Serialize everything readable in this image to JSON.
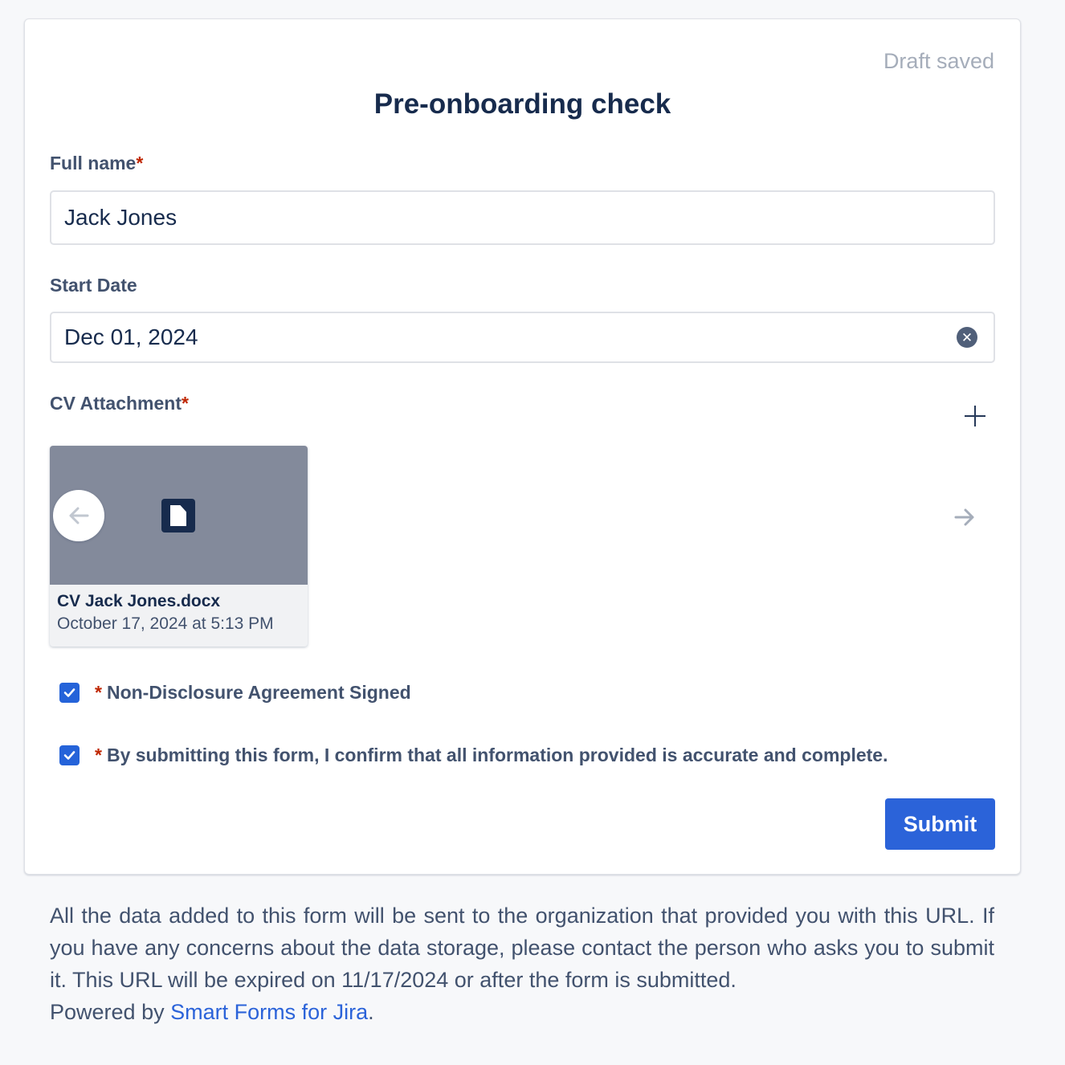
{
  "form": {
    "status": "Draft saved",
    "title": "Pre-onboarding check",
    "required_marker": "*",
    "full_name": {
      "label": "Full name",
      "value": "Jack Jones"
    },
    "start_date": {
      "label": "Start Date",
      "value": "Dec 01, 2024",
      "clear_icon": "close-circle-icon"
    },
    "cv_attachment": {
      "label": "CV Attachment",
      "add_icon": "plus-icon",
      "file_name": "CV Jack Jones.docx",
      "uploaded": "October 17, 2024 at 5:13 PM",
      "file_icon": "document-icon",
      "prev_icon": "arrow-left-icon",
      "next_icon": "arrow-right-icon"
    },
    "checkboxes": [
      {
        "label": "Non-Disclosure Agreement Signed",
        "checked": true
      },
      {
        "label": "By submitting this form, I confirm that all information provided is accurate and complete.",
        "checked": true
      }
    ],
    "submit_label": "Submit"
  },
  "footer": {
    "text": "All the data added to this form will be sent to the organization that provided you with this URL. If you have any concerns about the data storage, please contact the person who asks you to submit it. This URL will be expired on 11/17/2024 or after the form is submitted.",
    "powered_prefix": "Powered by ",
    "powered_link": "Smart Forms for Jira",
    "powered_suffix": "."
  },
  "colors": {
    "accent": "#2b63d9",
    "required": "#bf2600",
    "title": "#172b4d",
    "label": "#42526e",
    "muted": "#a5adba",
    "preview_bg": "#838a9b"
  }
}
